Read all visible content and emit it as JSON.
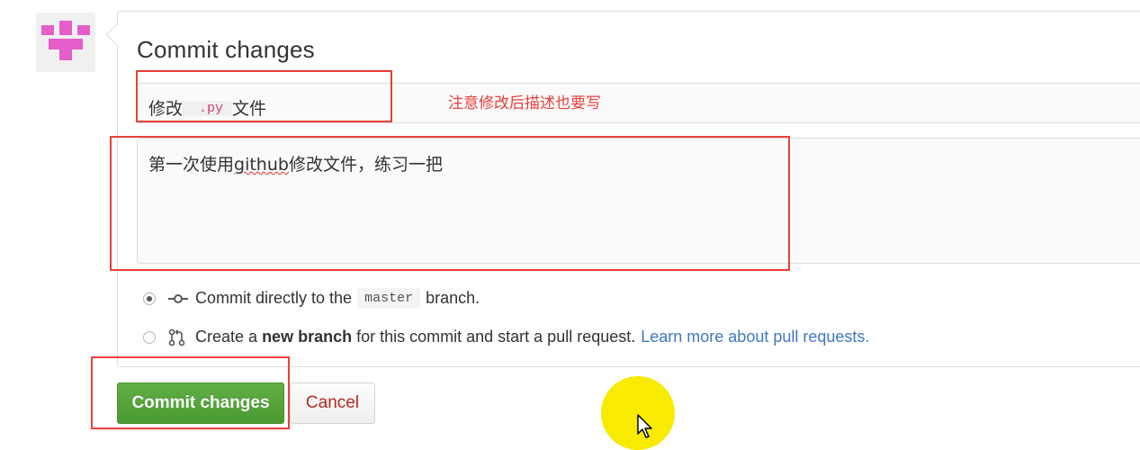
{
  "avatar": {
    "icon": "identicon-avatar",
    "color": "#e45fc9"
  },
  "form": {
    "title": "Commit changes",
    "summary": {
      "prefix": "修改",
      "code": ".py",
      "suffix": "文件"
    },
    "description": {
      "part1": "第一次使用",
      "misspelled": "github",
      "part2": "修改文件，练习一把"
    },
    "option_direct": {
      "text_before": "Commit directly to the",
      "branch": "master",
      "text_after": "branch.",
      "checked": true
    },
    "option_new_branch": {
      "text_before": "Create a",
      "bold": "new branch",
      "text_after": "for this commit and start a pull request.",
      "link": "Learn more about pull requests.",
      "checked": false
    },
    "buttons": {
      "commit": "Commit changes",
      "cancel": "Cancel"
    }
  },
  "annotation": {
    "note": "注意修改后描述也要写",
    "color": "#e8403a"
  },
  "cursor": {
    "highlight_color": "#f8ea00"
  }
}
